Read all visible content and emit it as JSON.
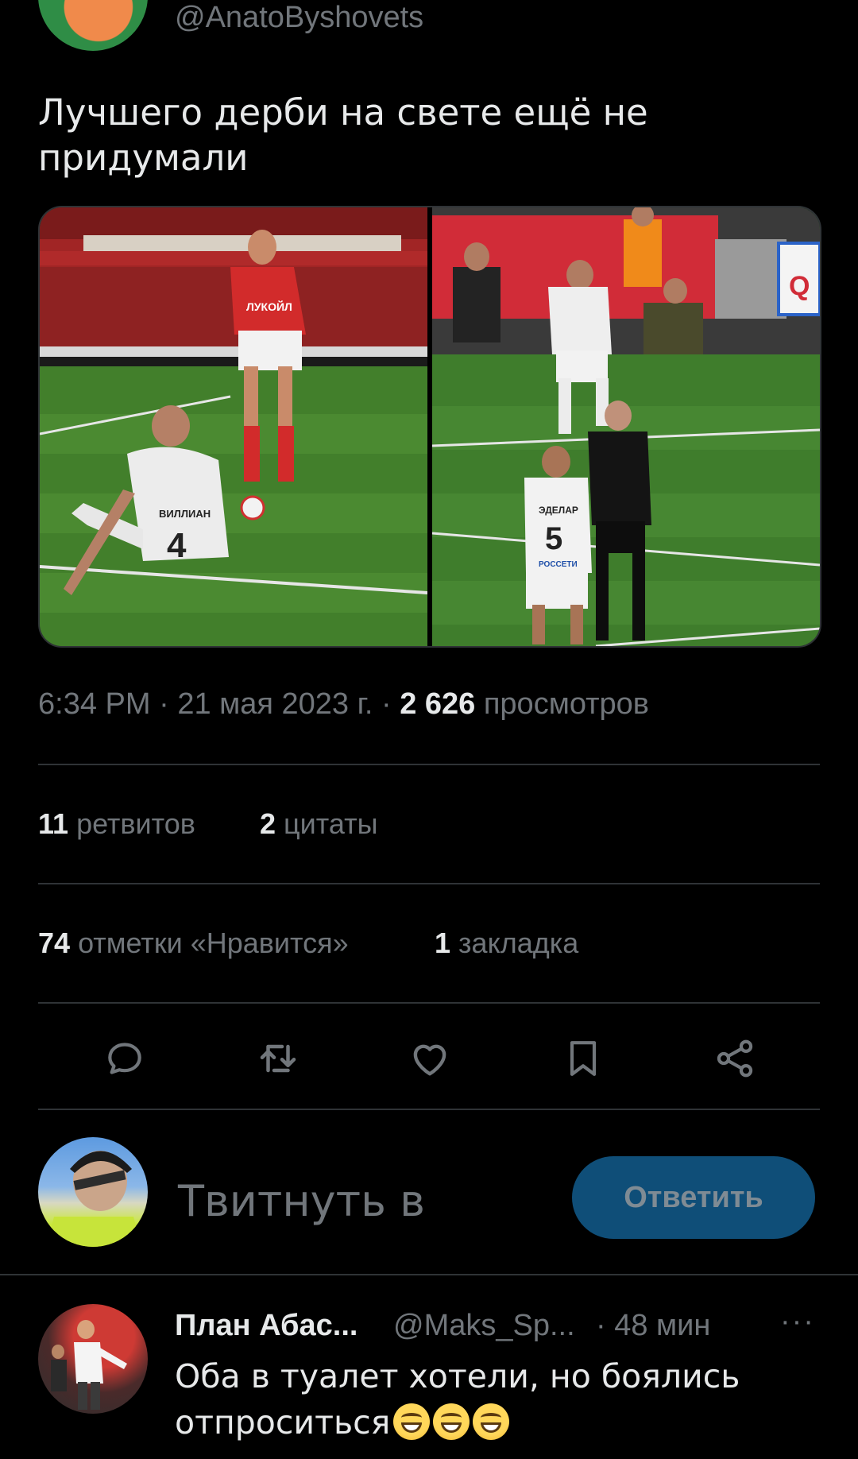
{
  "author": {
    "handle": "@AnatoByshovets"
  },
  "tweet": {
    "text": "Лучшего дерби на свете ещё не придумали",
    "media_left_alt": "Football players on pitch: player in red Spartak kit with ЛУКОЙЛ sponsor stands over seated player in white kit number 4 ВИЛЛИАН",
    "media_right_alt": "Player in white kit with РОССЕТИ sponsor number 5 beside referee in black, photographers in background",
    "left_jersey_sponsor": "ЛУКОЙЛ",
    "left_jersey_name": "ВИЛЛИАН",
    "left_jersey_number": "4",
    "right_jersey_name": "ЭДЕЛАР",
    "right_jersey_number": "5",
    "right_jersey_sponsor": "РОССЕТИ"
  },
  "meta": {
    "time": "6:34 PM",
    "date": "21 мая 2023 г.",
    "sep": "·",
    "views_count": "2 626",
    "views_label": "просмотров"
  },
  "stats": {
    "retweets_count": "11",
    "retweets_label": "ретвитов",
    "quotes_count": "2",
    "quotes_label": "цитаты",
    "likes_count": "74",
    "likes_label": "отметки «Нравится»",
    "bookmarks_count": "1",
    "bookmarks_label": "закладка"
  },
  "actions": [
    "reply-icon",
    "retweet-icon",
    "like-icon",
    "bookmark-icon",
    "share-icon"
  ],
  "composer": {
    "placeholder": "Твитнуть в",
    "button_label": "Ответить"
  },
  "comment": {
    "name": "План Абас...",
    "handle": "@Maks_Sp...",
    "time": "· 48 мин",
    "more": "···",
    "text": "Оба в туалет хотели, но боялись отпроситься"
  },
  "colors": {
    "background": "#000000",
    "text": "#e7e9ea",
    "muted": "#71767b",
    "divider": "#2f3336",
    "reply_button": "#0f4e78"
  }
}
